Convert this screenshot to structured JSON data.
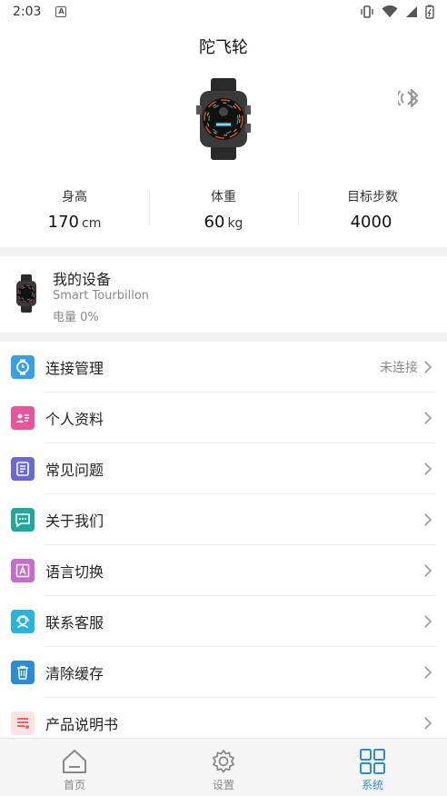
{
  "status_bar": {
    "time": "2:03",
    "notification_letter": "A"
  },
  "header": {
    "title": "陀飞轮"
  },
  "stats": [
    {
      "label": "身高",
      "value": "170",
      "unit": "cm"
    },
    {
      "label": "体重",
      "value": "60",
      "unit": "kg"
    },
    {
      "label": "目标步数",
      "value": "4000",
      "unit": ""
    }
  ],
  "device": {
    "title": "我的设备",
    "model": "Smart Tourbillon",
    "battery_label": "电量",
    "battery_value": "0%"
  },
  "menu": [
    {
      "label": "连接管理",
      "status": "未连接",
      "icon": "watch-icon",
      "color": "#3a9ee8"
    },
    {
      "label": "个人资料",
      "icon": "profile-card-icon",
      "color": "#e8559a"
    },
    {
      "label": "常见问题",
      "icon": "document-icon",
      "color": "#6a6ad0"
    },
    {
      "label": "关于我们",
      "icon": "chat-bubble-icon",
      "color": "#21a89a"
    },
    {
      "label": "语言切换",
      "icon": "language-icon",
      "color": "#c86ad0"
    },
    {
      "label": "联系客服",
      "icon": "customer-service-icon",
      "color": "#2ab4d8"
    },
    {
      "label": "清除缓存",
      "icon": "trash-icon",
      "color": "#2a8cd6"
    },
    {
      "label": "产品说明书",
      "icon": "manual-icon",
      "color": "#f06060"
    }
  ],
  "tabs": [
    {
      "label": "首页",
      "icon": "home-icon",
      "active": false
    },
    {
      "label": "设置",
      "icon": "gear-icon",
      "active": false
    },
    {
      "label": "系统",
      "icon": "grid-icon",
      "active": true
    }
  ],
  "colors": {
    "accent": "#2a8cd6",
    "divider": "#eeeeee",
    "muted": "#888888"
  }
}
